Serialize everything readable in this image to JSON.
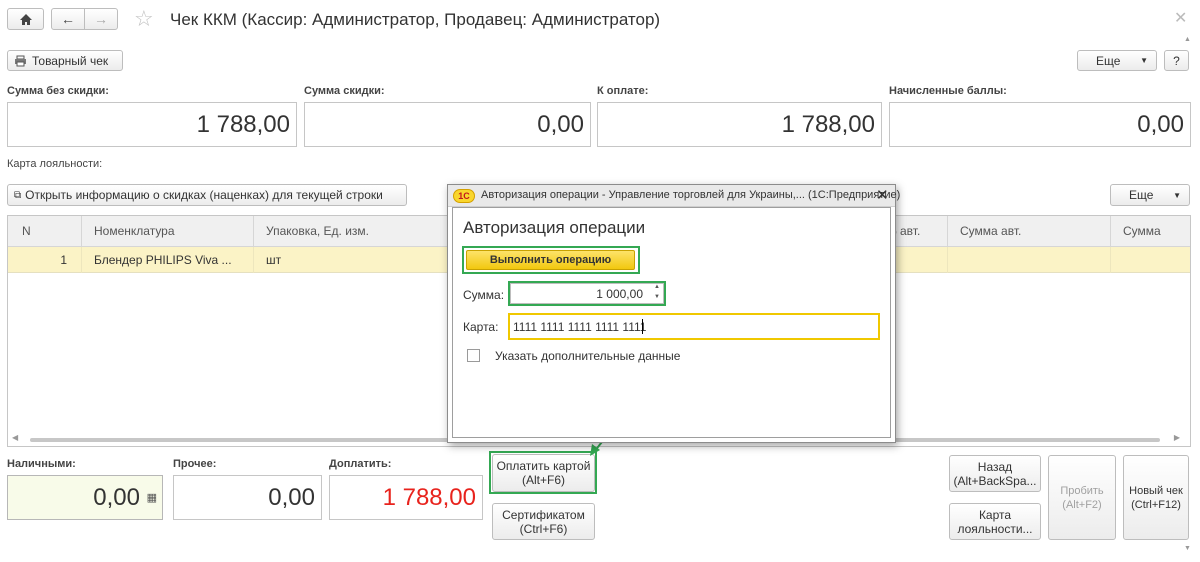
{
  "window": {
    "title": "Чек ККМ (Кассир: Администратор, Продавец: Администратор)"
  },
  "toolbar": {
    "sales_receipt_label": "Товарный чек",
    "more_label": "Еще",
    "help_label": "?"
  },
  "totals": {
    "sum_without_discount_label": "Сумма без скидки:",
    "sum_without_discount_value": "1 788,00",
    "discount_sum_label": "Сумма скидки:",
    "discount_sum_value": "0,00",
    "to_pay_label": "К оплате:",
    "to_pay_value": "1 788,00",
    "accrued_points_label": "Начисленные баллы:",
    "accrued_points_value": "0,00"
  },
  "loyalty_card_label": "Карта лояльности:",
  "discount_info_button_label": "Открыть информацию о скидках (наценках) для текущей строки",
  "table_more_label": "Еще",
  "table": {
    "columns": [
      "N",
      "Номенклатура",
      "Упаковка, Ед. изм.",
      "% авт.",
      "Сумма авт.",
      "Сумма"
    ],
    "rows": [
      {
        "n": "1",
        "item": "Блендер PHILIPS Viva ...",
        "unit": "шт"
      }
    ]
  },
  "payment": {
    "cash_label": "Наличными:",
    "cash_value": "0,00",
    "other_label": "Прочее:",
    "other_value": "0,00",
    "surcharge_label": "Доплатить:",
    "surcharge_value": "1 788,00",
    "surcharge_color": "#e8231d"
  },
  "actions": {
    "pay_by_card_line1": "Оплатить картой",
    "pay_by_card_line2": "(Alt+F6)",
    "certificate_line1": "Сертификатом",
    "certificate_line2": "(Ctrl+F6)",
    "back_line1": "Назад",
    "back_line2": "(Alt+BackSpa...",
    "loyalty_card_line1": "Карта",
    "loyalty_card_line2": "лояльности...",
    "punch_line1": "Пробить",
    "punch_line2": "(Alt+F2)",
    "new_receipt_line1": "Новый чек",
    "new_receipt_line2": "(Ctrl+F12)"
  },
  "dialog": {
    "window_title": "Авторизация операции - Управление торговлей для Украины,... (1С:Предприятие)",
    "heading": "Авторизация операции",
    "execute_button_label": "Выполнить операцию",
    "sum_label": "Сумма:",
    "sum_value": "1 000,00",
    "card_label": "Карта:",
    "card_value": "1111 1111 1111 1111 1111",
    "extra_data_label": "Указать дополнительные данные",
    "extra_data_checked": false
  },
  "colors": {
    "highlight_green": "#34a853",
    "execute_button_yellow": "#f5d21c",
    "selected_row": "#fbf3c6"
  }
}
